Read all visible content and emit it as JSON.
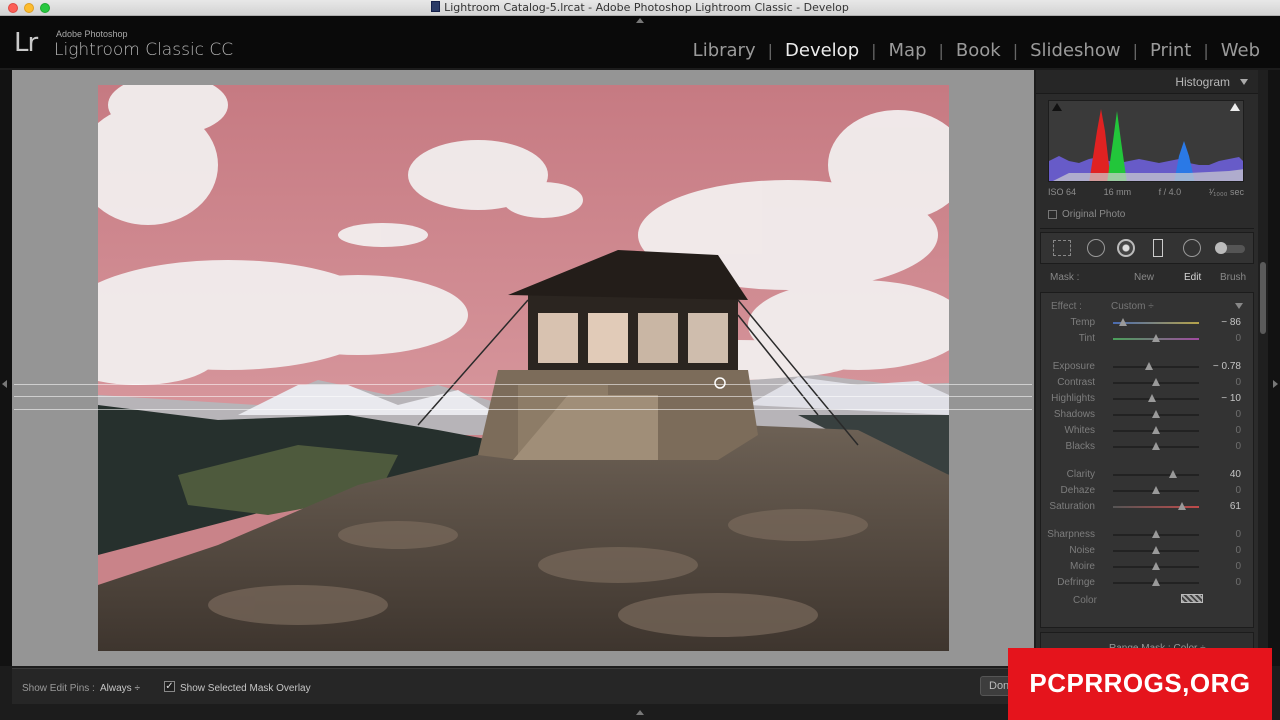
{
  "window": {
    "title": "Lightroom Catalog-5.lrcat - Adobe Photoshop Lightroom Classic - Develop"
  },
  "brand": {
    "logo": "Lr",
    "small": "Adobe Photoshop",
    "main": "Lightroom Classic CC"
  },
  "modules": [
    {
      "label": "Library",
      "active": false
    },
    {
      "label": "Develop",
      "active": true
    },
    {
      "label": "Map",
      "active": false
    },
    {
      "label": "Book",
      "active": false
    },
    {
      "label": "Slideshow",
      "active": false
    },
    {
      "label": "Print",
      "active": false
    },
    {
      "label": "Web",
      "active": false
    }
  ],
  "histogram": {
    "title": "Histogram",
    "iso": "ISO 64",
    "focal": "16 mm",
    "aperture": "f / 4.0",
    "shutter": "¹⁄₁₀₀₀ sec",
    "original_photo": "Original Photo"
  },
  "mask": {
    "label": "Mask :",
    "new": "New",
    "edit": "Edit",
    "brush": "Brush"
  },
  "effect": {
    "label": "Effect :",
    "value": "Custom ÷"
  },
  "sliders": [
    {
      "label": "Temp",
      "value": "− 86",
      "pos": 0.12,
      "highlight": true
    },
    {
      "label": "Tint",
      "value": "0",
      "pos": 0.5,
      "highlight": false
    },
    {
      "label": "Exposure",
      "value": "− 0.78",
      "pos": 0.42,
      "highlight": true
    },
    {
      "label": "Contrast",
      "value": "0",
      "pos": 0.5,
      "highlight": false
    },
    {
      "label": "Highlights",
      "value": "− 10",
      "pos": 0.45,
      "highlight": true
    },
    {
      "label": "Shadows",
      "value": "0",
      "pos": 0.5,
      "highlight": false
    },
    {
      "label": "Whites",
      "value": "0",
      "pos": 0.5,
      "highlight": false
    },
    {
      "label": "Blacks",
      "value": "0",
      "pos": 0.5,
      "highlight": false
    },
    {
      "label": "Clarity",
      "value": "40",
      "pos": 0.7,
      "highlight": true
    },
    {
      "label": "Dehaze",
      "value": "0",
      "pos": 0.5,
      "highlight": false
    },
    {
      "label": "Saturation",
      "value": "61",
      "pos": 0.8,
      "highlight": true
    },
    {
      "label": "Sharpness",
      "value": "0",
      "pos": 0.5,
      "highlight": false
    },
    {
      "label": "Noise",
      "value": "0",
      "pos": 0.5,
      "highlight": false
    },
    {
      "label": "Moire",
      "value": "0",
      "pos": 0.5,
      "highlight": false
    },
    {
      "label": "Defringe",
      "value": "0",
      "pos": 0.5,
      "highlight": false
    }
  ],
  "color": {
    "label": "Color"
  },
  "range_mask": {
    "label": "Range Mask : Color ÷"
  },
  "toolbar": {
    "edit_pins_label": "Show Edit Pins :",
    "edit_pins_value": "Always ÷",
    "mask_overlay_label": "Show Selected Mask Overlay",
    "done_label": "Done"
  },
  "watermark": "PCPRROGS,ORG"
}
